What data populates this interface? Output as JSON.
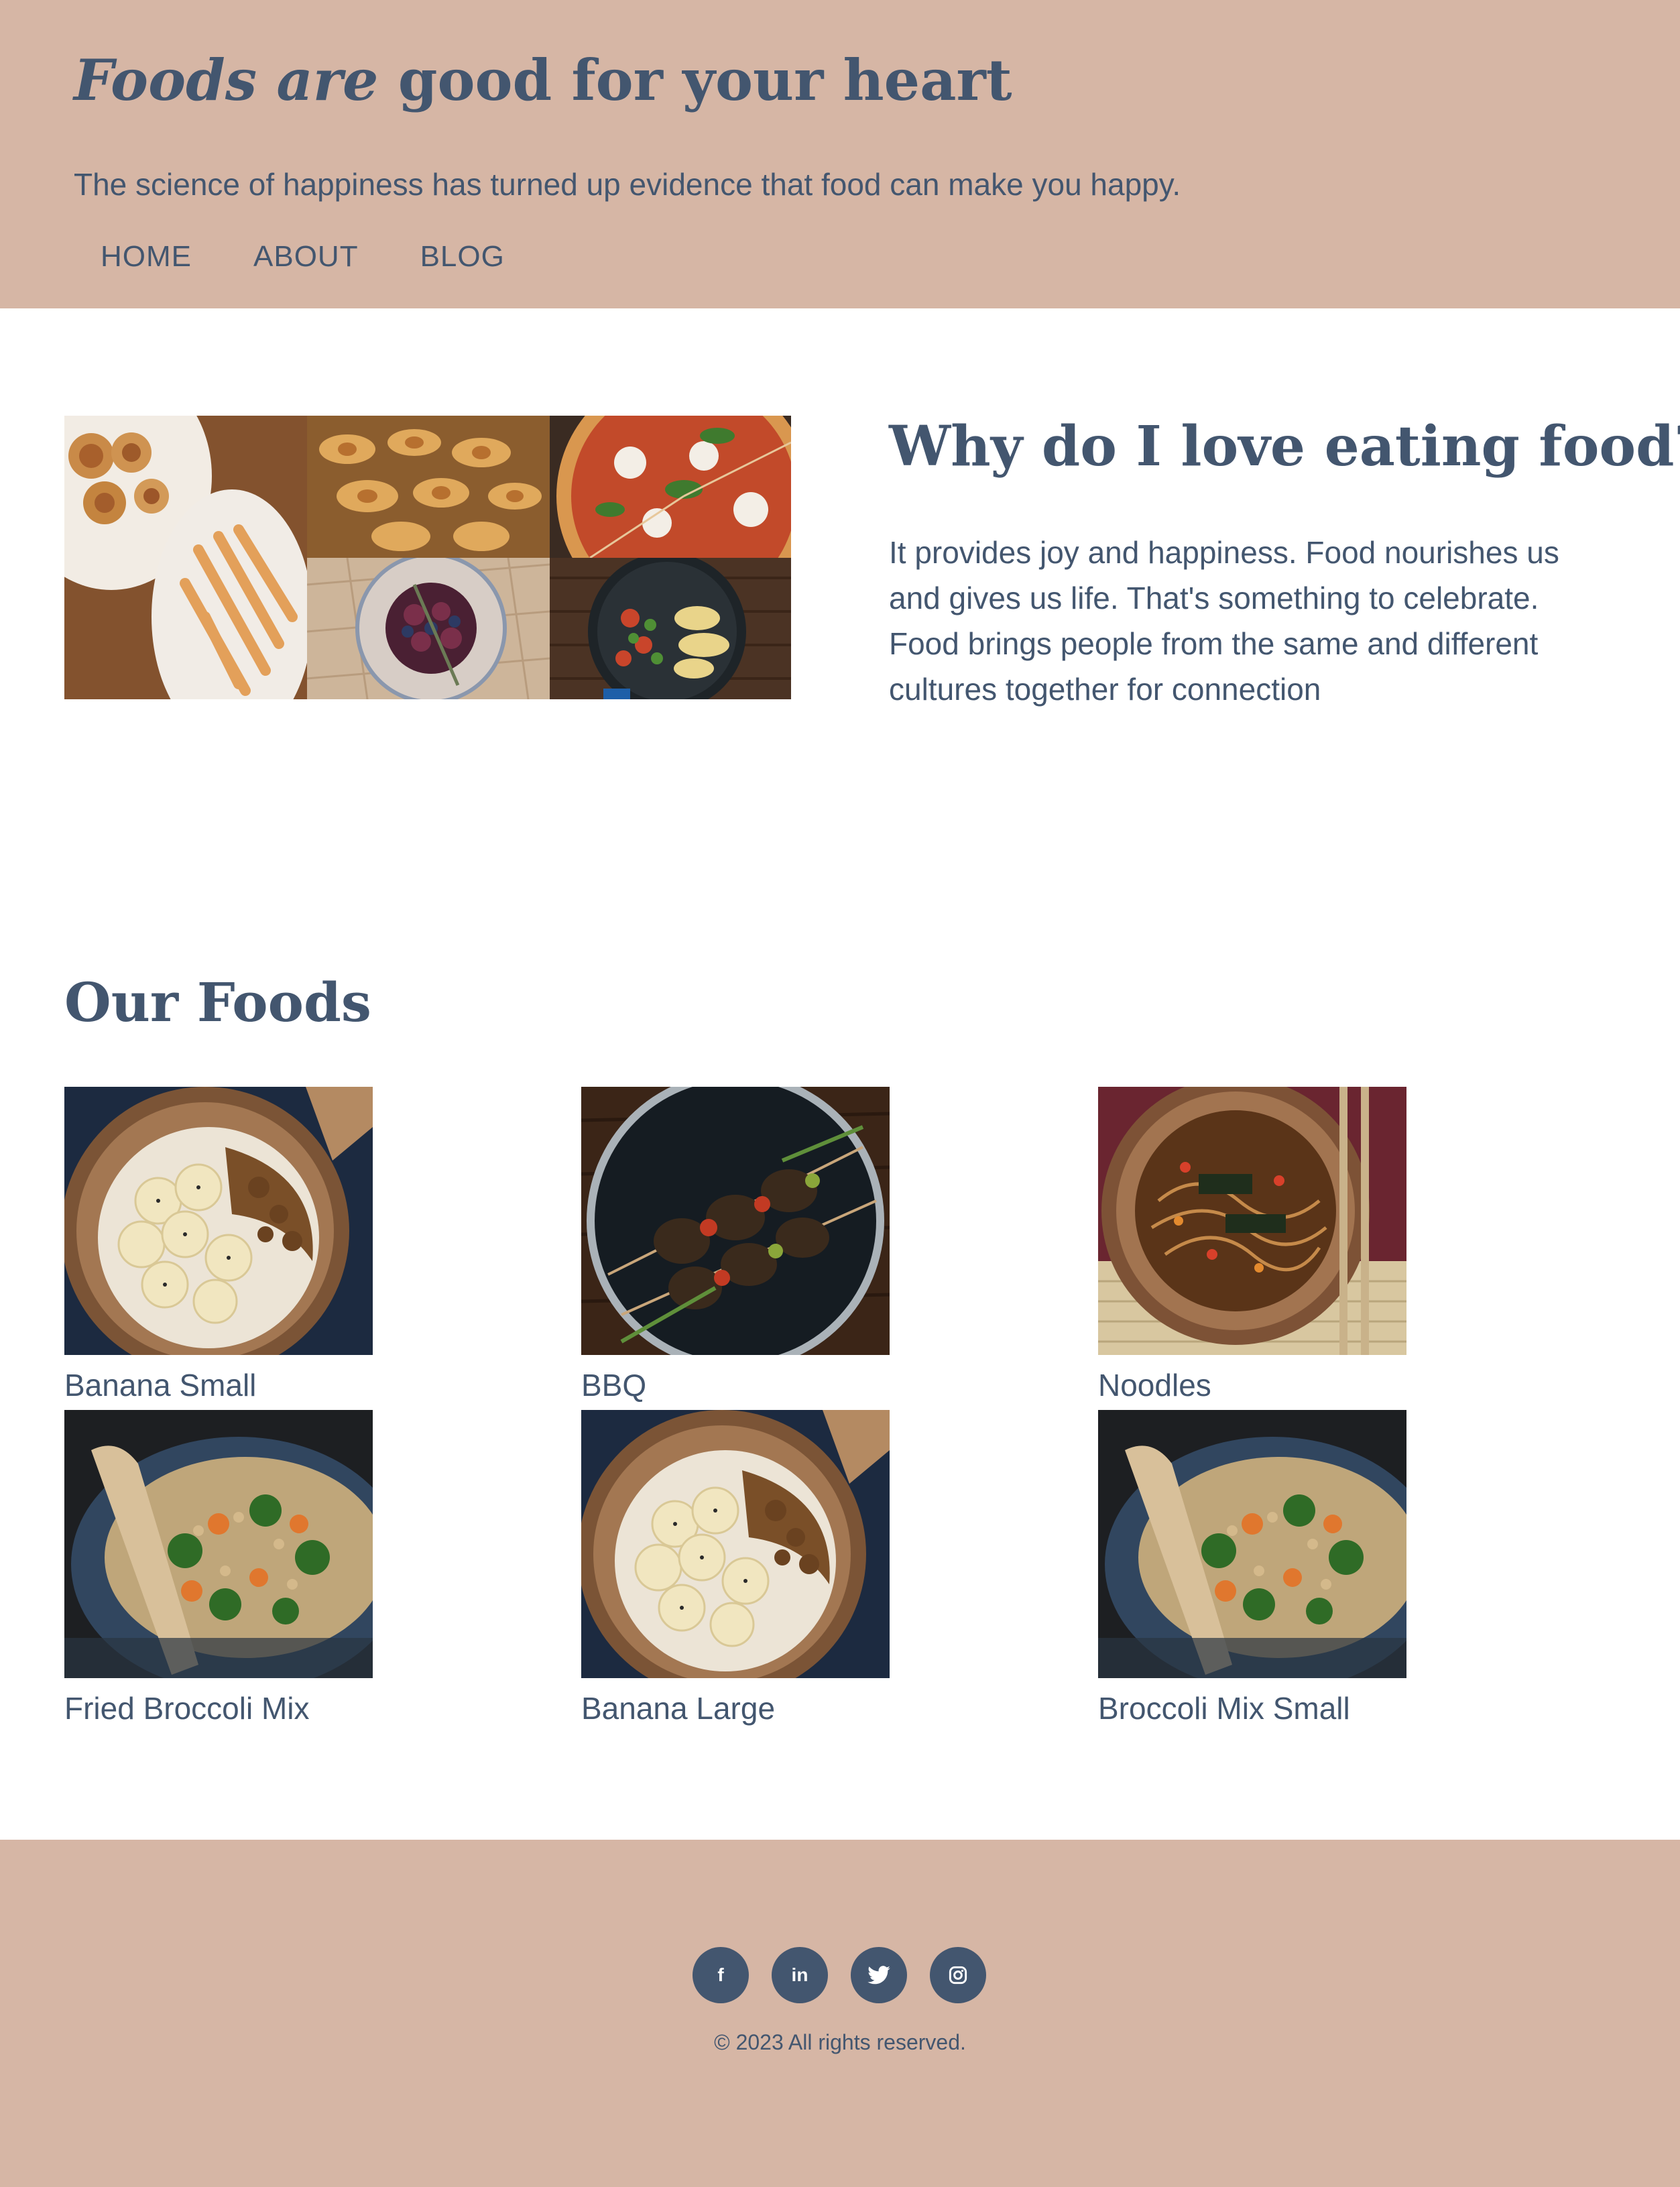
{
  "header": {
    "title_italic": "Foods are",
    "title_rest": " good for your heart",
    "tagline": "The science of happiness has turned up evidence that food can make you happy.",
    "nav": [
      "HOME",
      "ABOUT",
      "BLOG"
    ]
  },
  "intro": {
    "heading": "Why do I love eating food?",
    "text": "It provides joy and happiness. Food nourishes us and gives us life. That's something to celebrate. Food brings people from the same and different cultures together for connection"
  },
  "foods": {
    "heading": "Our Foods",
    "items": [
      {
        "label": "Banana Small",
        "image": "banana-bowl"
      },
      {
        "label": "BBQ",
        "image": "bbq-skewers"
      },
      {
        "label": "Noodles",
        "image": "noodles-bowl"
      },
      {
        "label": "Fried Broccoli Mix",
        "image": "broccoli-pan"
      },
      {
        "label": "Banana Large",
        "image": "banana-bowl"
      },
      {
        "label": "Broccoli Mix Small",
        "image": "broccoli-pan"
      }
    ]
  },
  "footer": {
    "socials": [
      {
        "icon": "facebook-icon",
        "glyph": "f"
      },
      {
        "icon": "linkedin-icon",
        "glyph": "in"
      },
      {
        "icon": "twitter-icon",
        "glyph": "t"
      },
      {
        "icon": "instagram-icon",
        "glyph": "◎"
      }
    ],
    "copyright": "© 2023 All rights reserved."
  },
  "colors": {
    "header_bg": "#d6b6a5",
    "text": "#43566f",
    "page_bg": "#ffffff"
  }
}
